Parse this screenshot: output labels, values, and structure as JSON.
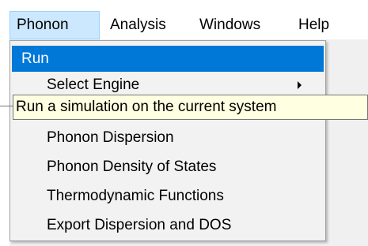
{
  "menubar": {
    "items": [
      {
        "label": "Phonon"
      },
      {
        "label": "Analysis"
      },
      {
        "label": "Windows"
      },
      {
        "label": "Help"
      }
    ]
  },
  "dropdown": {
    "items": [
      {
        "label": "Run",
        "highlighted": true
      },
      {
        "label": "Select Engine",
        "has_submenu": true
      },
      {
        "label": "Phonon Dispersion"
      },
      {
        "label": "Phonon Density of States"
      },
      {
        "label": "Thermodynamic Functions"
      },
      {
        "label": "Export Dispersion and DOS"
      }
    ]
  },
  "tooltip": {
    "text": "Run a simulation on the current system"
  },
  "colors": {
    "highlight": "#0078d7",
    "active_menu": "#cce8ff",
    "tooltip_bg": "#ffffe1"
  }
}
